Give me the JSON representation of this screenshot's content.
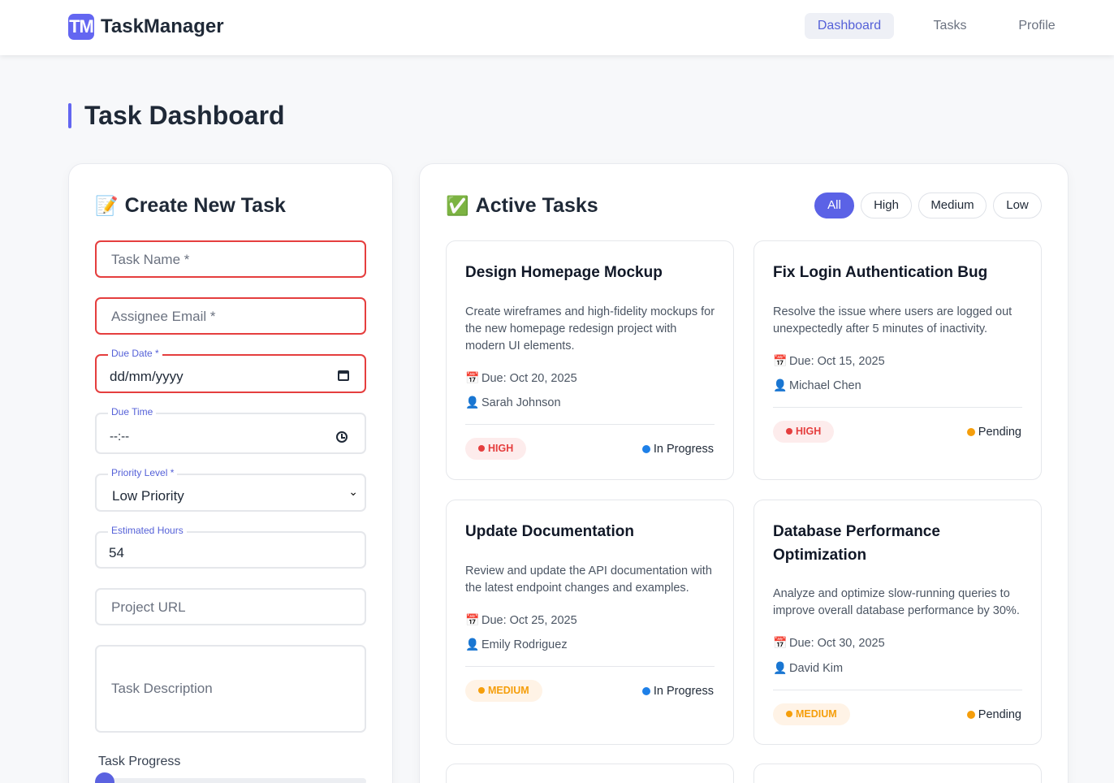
{
  "header": {
    "logo_text": "TM",
    "brand": "TaskManager",
    "nav": [
      {
        "label": "Dashboard",
        "active": true
      },
      {
        "label": "Tasks",
        "active": false
      },
      {
        "label": "Profile",
        "active": false
      }
    ]
  },
  "page": {
    "title": "Task Dashboard"
  },
  "create_task": {
    "heading_emoji": "📝",
    "heading": "Create New Task",
    "task_name": {
      "placeholder": "Task Name *",
      "value": ""
    },
    "assignee_email": {
      "placeholder": "Assignee Email *",
      "value": ""
    },
    "due_date": {
      "label": "Due Date *",
      "value": "dd/mm/yyyy"
    },
    "due_time": {
      "label": "Due Time",
      "value": "--:--"
    },
    "priority_level": {
      "label": "Priority Level *",
      "selected": "Low Priority"
    },
    "estimated_hours": {
      "label": "Estimated Hours",
      "value": "54"
    },
    "project_url": {
      "placeholder": "Project URL",
      "value": ""
    },
    "task_description": {
      "placeholder": "Task Description",
      "value": ""
    },
    "task_progress": {
      "label": "Task Progress",
      "value_percent": 0
    }
  },
  "active_tasks": {
    "heading_emoji": "✅",
    "heading": "Active Tasks",
    "filters": [
      {
        "label": "All",
        "active": true
      },
      {
        "label": "High",
        "active": false
      },
      {
        "label": "Medium",
        "active": false
      },
      {
        "label": "Low",
        "active": false
      }
    ],
    "tasks": [
      {
        "title": "Design Homepage Mockup",
        "description": "Create wireframes and high-fidelity mockups for the new homepage redesign project with modern UI elements.",
        "due": "Due: Oct 20, 2025",
        "assignee": "Sarah Johnson",
        "priority": "HIGH",
        "status": "In Progress",
        "status_color": "#1e80e8"
      },
      {
        "title": "Fix Login Authentication Bug",
        "description": "Resolve the issue where users are logged out unexpectedly after 5 minutes of inactivity.",
        "due": "Due: Oct 15, 2025",
        "assignee": "Michael Chen",
        "priority": "HIGH",
        "status": "Pending",
        "status_color": "#f59e0b"
      },
      {
        "title": "Update Documentation",
        "description": "Review and update the API documentation with the latest endpoint changes and examples.",
        "due": "Due: Oct 25, 2025",
        "assignee": "Emily Rodriguez",
        "priority": "MEDIUM",
        "status": "In Progress",
        "status_color": "#1e80e8"
      },
      {
        "title": "Database Performance Optimization",
        "description": "Analyze and optimize slow-running queries to improve overall database performance by 30%.",
        "due": "Due: Oct 30, 2025",
        "assignee": "David Kim",
        "priority": "MEDIUM",
        "status": "Pending",
        "status_color": "#f59e0b"
      }
    ]
  },
  "icons": {
    "calendar": "calendar-icon",
    "person": "person-icon"
  },
  "colors": {
    "accent": "#6366f1",
    "error_border": "#e53e3e",
    "high": "#e53e3e",
    "medium": "#f59e0b",
    "in_progress": "#1e80e8",
    "pending": "#f59e0b"
  }
}
